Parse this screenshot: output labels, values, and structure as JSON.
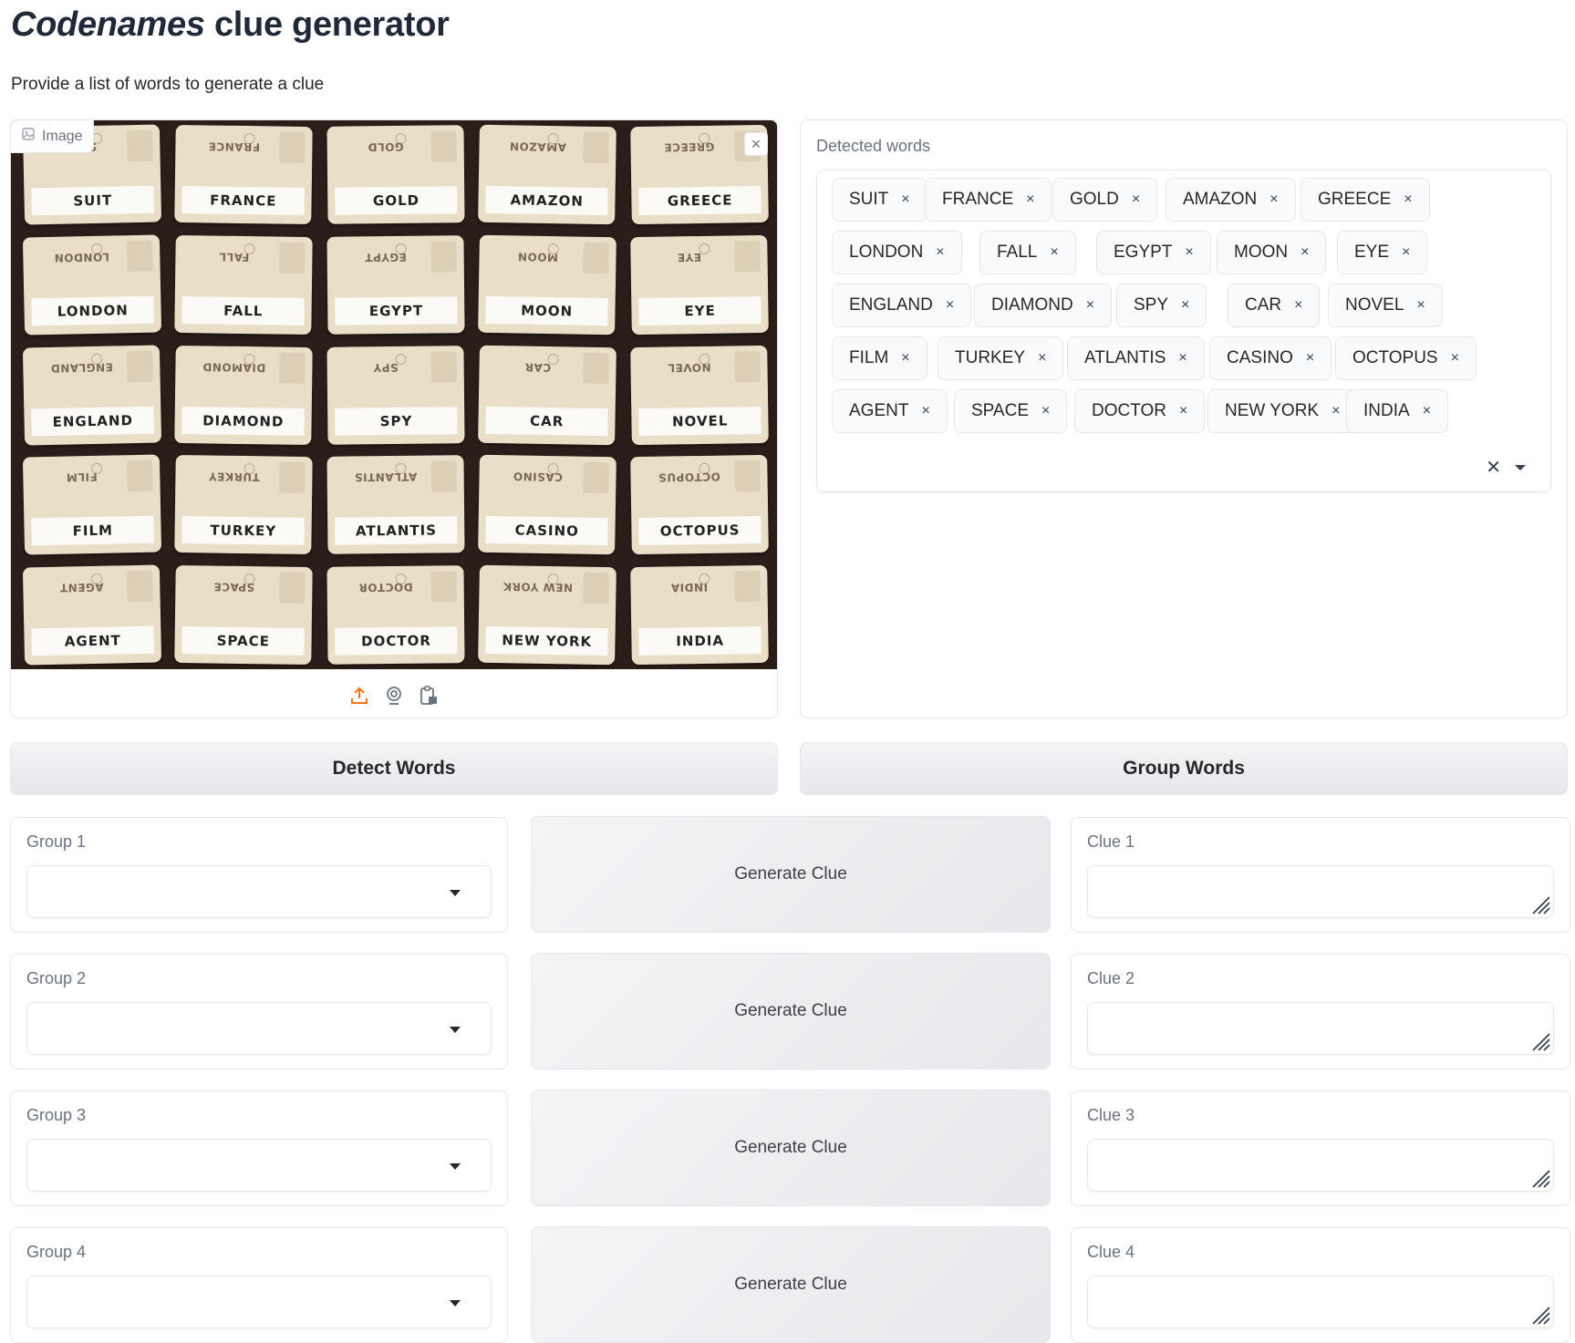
{
  "header": {
    "title_italic": "Codenames",
    "title_rest": " clue generator",
    "subtitle": "Provide a list of words to generate a clue"
  },
  "image_input": {
    "label": "Image",
    "close_glyph": "×",
    "cards": [
      {
        "word": "SUIT"
      },
      {
        "word": "FRANCE"
      },
      {
        "word": "GOLD"
      },
      {
        "word": "AMAZON"
      },
      {
        "word": "GREECE"
      },
      {
        "word": "LONDON"
      },
      {
        "word": "FALL"
      },
      {
        "word": "EGYPT"
      },
      {
        "word": "MOON"
      },
      {
        "word": "EYE"
      },
      {
        "word": "ENGLAND"
      },
      {
        "word": "DIAMOND"
      },
      {
        "word": "SPY"
      },
      {
        "word": "CAR"
      },
      {
        "word": "NOVEL"
      },
      {
        "word": "FILM"
      },
      {
        "word": "TURKEY"
      },
      {
        "word": "ATLANTIS"
      },
      {
        "word": "CASINO"
      },
      {
        "word": "OCTOPUS"
      },
      {
        "word": "AGENT"
      },
      {
        "word": "SPACE"
      },
      {
        "word": "DOCTOR"
      },
      {
        "word": "NEW YORK"
      },
      {
        "word": "INDIA"
      }
    ],
    "toolbar_icons": [
      "upload-icon",
      "webcam-icon",
      "clipboard-paste-icon"
    ],
    "accent_color": "#f97316"
  },
  "detected": {
    "label": "Detected words",
    "words": [
      "SUIT",
      "FRANCE",
      "GOLD",
      "AMAZON",
      "GREECE",
      "LONDON",
      "FALL",
      "EGYPT",
      "MOON",
      "EYE",
      "ENGLAND",
      "DIAMOND",
      "SPY",
      "CAR",
      "NOVEL",
      "FILM",
      "TURKEY",
      "ATLANTIS",
      "CASINO",
      "OCTOPUS",
      "AGENT",
      "SPACE",
      "DOCTOR",
      "NEW YORK",
      "INDIA"
    ],
    "remove_glyph": "×",
    "clear_glyph": "✕"
  },
  "buttons": {
    "detect": "Detect Words",
    "group": "Group Words"
  },
  "groups": [
    {
      "label": "Group 1",
      "value": "",
      "generate": "Generate Clue",
      "clue_label": "Clue 1",
      "clue_value": ""
    },
    {
      "label": "Group 2",
      "value": "",
      "generate": "Generate Clue",
      "clue_label": "Clue 2",
      "clue_value": ""
    },
    {
      "label": "Group 3",
      "value": "",
      "generate": "Generate Clue",
      "clue_label": "Clue 3",
      "clue_value": ""
    },
    {
      "label": "Group 4",
      "value": "",
      "generate": "Generate Clue",
      "clue_label": "Clue 4",
      "clue_value": ""
    }
  ]
}
